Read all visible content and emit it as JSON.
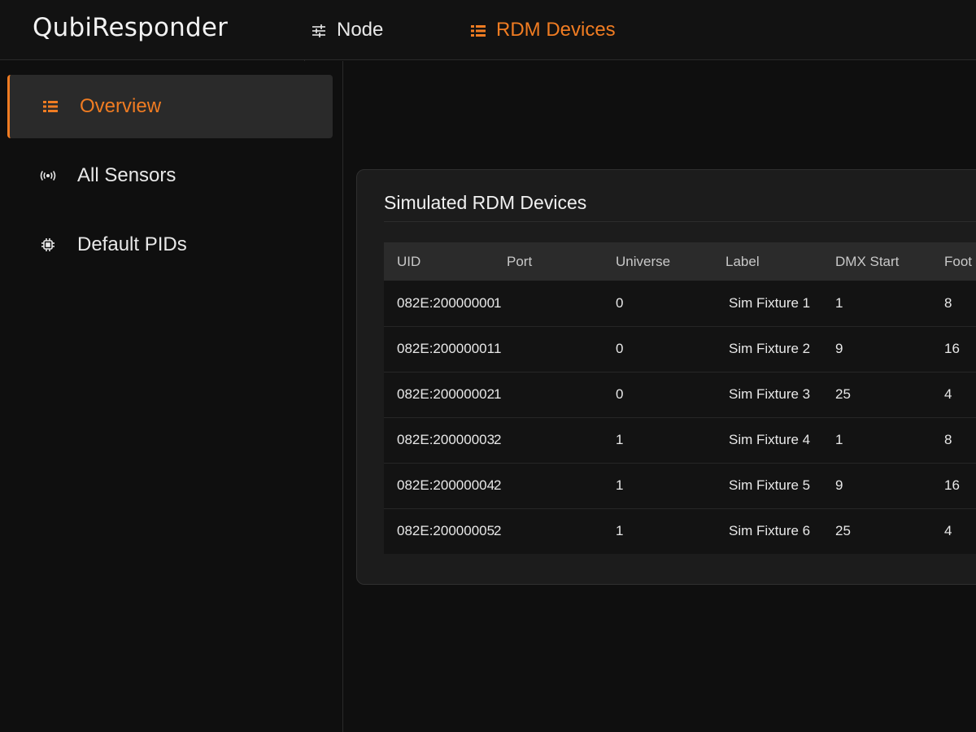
{
  "app": {
    "brand": "QubiResponder"
  },
  "topnav": {
    "node_label": "Node",
    "rdm_label": "RDM Devices",
    "active": "RDM Devices"
  },
  "sidebar": {
    "items": [
      {
        "label": "Overview",
        "icon": "list-icon",
        "active": true
      },
      {
        "label": "All Sensors",
        "icon": "broadcast-icon",
        "active": false
      },
      {
        "label": "Default PIDs",
        "icon": "chip-icon",
        "active": false
      }
    ]
  },
  "main": {
    "card_title": "Simulated RDM Devices",
    "table": {
      "columns": [
        "UID",
        "Port",
        "Universe",
        "Label",
        "DMX Start",
        "Foot"
      ],
      "rows": [
        [
          "082E:20000000",
          "1",
          "0",
          "Sim Fixture 1",
          "1",
          "8"
        ],
        [
          "082E:20000001",
          "1",
          "0",
          "Sim Fixture 2",
          "9",
          "16"
        ],
        [
          "082E:20000002",
          "1",
          "0",
          "Sim Fixture 3",
          "25",
          "4"
        ],
        [
          "082E:20000003",
          "2",
          "1",
          "Sim Fixture 4",
          "1",
          "8"
        ],
        [
          "082E:20000004",
          "2",
          "1",
          "Sim Fixture 5",
          "9",
          "16"
        ],
        [
          "082E:20000005",
          "2",
          "1",
          "Sim Fixture 6",
          "25",
          "4"
        ]
      ]
    }
  },
  "colors": {
    "accent": "#f07c22",
    "background": "#0f0f0f",
    "card": "#1c1c1c"
  }
}
